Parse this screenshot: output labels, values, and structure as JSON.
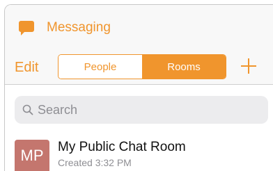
{
  "header": {
    "app_icon": "chat-bubble-icon",
    "title": "Messaging"
  },
  "toolbar": {
    "edit_label": "Edit",
    "segments": [
      {
        "label": "People",
        "selected": false
      },
      {
        "label": "Rooms",
        "selected": true
      }
    ],
    "add_icon": "plus-icon"
  },
  "search": {
    "icon": "search-icon",
    "placeholder": "Search"
  },
  "rooms": [
    {
      "initials": "MP",
      "name": "My Public Chat Room",
      "subtitle": "Created 3:32 PM"
    }
  ],
  "colors": {
    "accent": "#f0952d",
    "avatar": "#c4766e",
    "search_bg": "#ececee"
  }
}
